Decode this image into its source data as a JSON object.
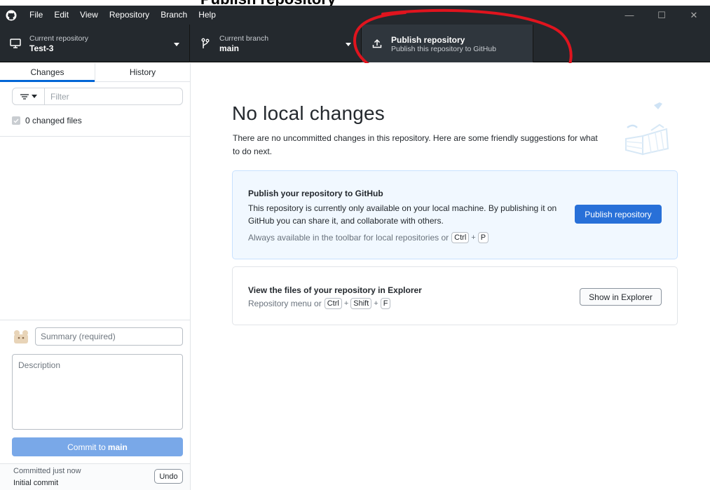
{
  "banner": {
    "text": "Publish repository"
  },
  "menu": {
    "items": [
      "File",
      "Edit",
      "View",
      "Repository",
      "Branch",
      "Help"
    ]
  },
  "window_controls": {
    "minimize": "—",
    "maximize": "☐",
    "close": "✕"
  },
  "toolbar": {
    "repository": {
      "label": "Current repository",
      "value": "Test-3"
    },
    "branch": {
      "label": "Current branch",
      "value": "main"
    },
    "publish": {
      "label": "Publish repository",
      "value": "Publish this repository to GitHub"
    }
  },
  "sidebar": {
    "tabs": [
      {
        "label": "Changes",
        "active": true
      },
      {
        "label": "History",
        "active": false
      }
    ],
    "filter": {
      "placeholder": "Filter"
    },
    "changed_files": "0 changed files",
    "commit": {
      "summary_placeholder": "Summary (required)",
      "description_placeholder": "Description",
      "button_prefix": "Commit to ",
      "button_branch": "main"
    },
    "last_commit": {
      "time": "Committed just now",
      "message": "Initial commit",
      "undo_label": "Undo"
    }
  },
  "main": {
    "heading": "No local changes",
    "subtext": "There are no uncommitted changes in this repository. Here are some friendly suggestions for what to do next.",
    "publish_card": {
      "title": "Publish your repository to GitHub",
      "description": "This repository is currently only available on your local machine. By publishing it on GitHub you can share it, and collaborate with others.",
      "hint_prefix": "Always available in the toolbar for local repositories or",
      "keys": [
        "Ctrl",
        "P"
      ],
      "button": "Publish repository"
    },
    "explorer_card": {
      "title": "View the files of your repository in Explorer",
      "hint_prefix": "Repository menu or",
      "keys": [
        "Ctrl",
        "Shift",
        "F"
      ],
      "button": "Show in Explorer"
    }
  },
  "colors": {
    "toolbar_bg": "#24292e",
    "accent_blue": "#2870d8",
    "annotation_red": "#e0141e"
  }
}
